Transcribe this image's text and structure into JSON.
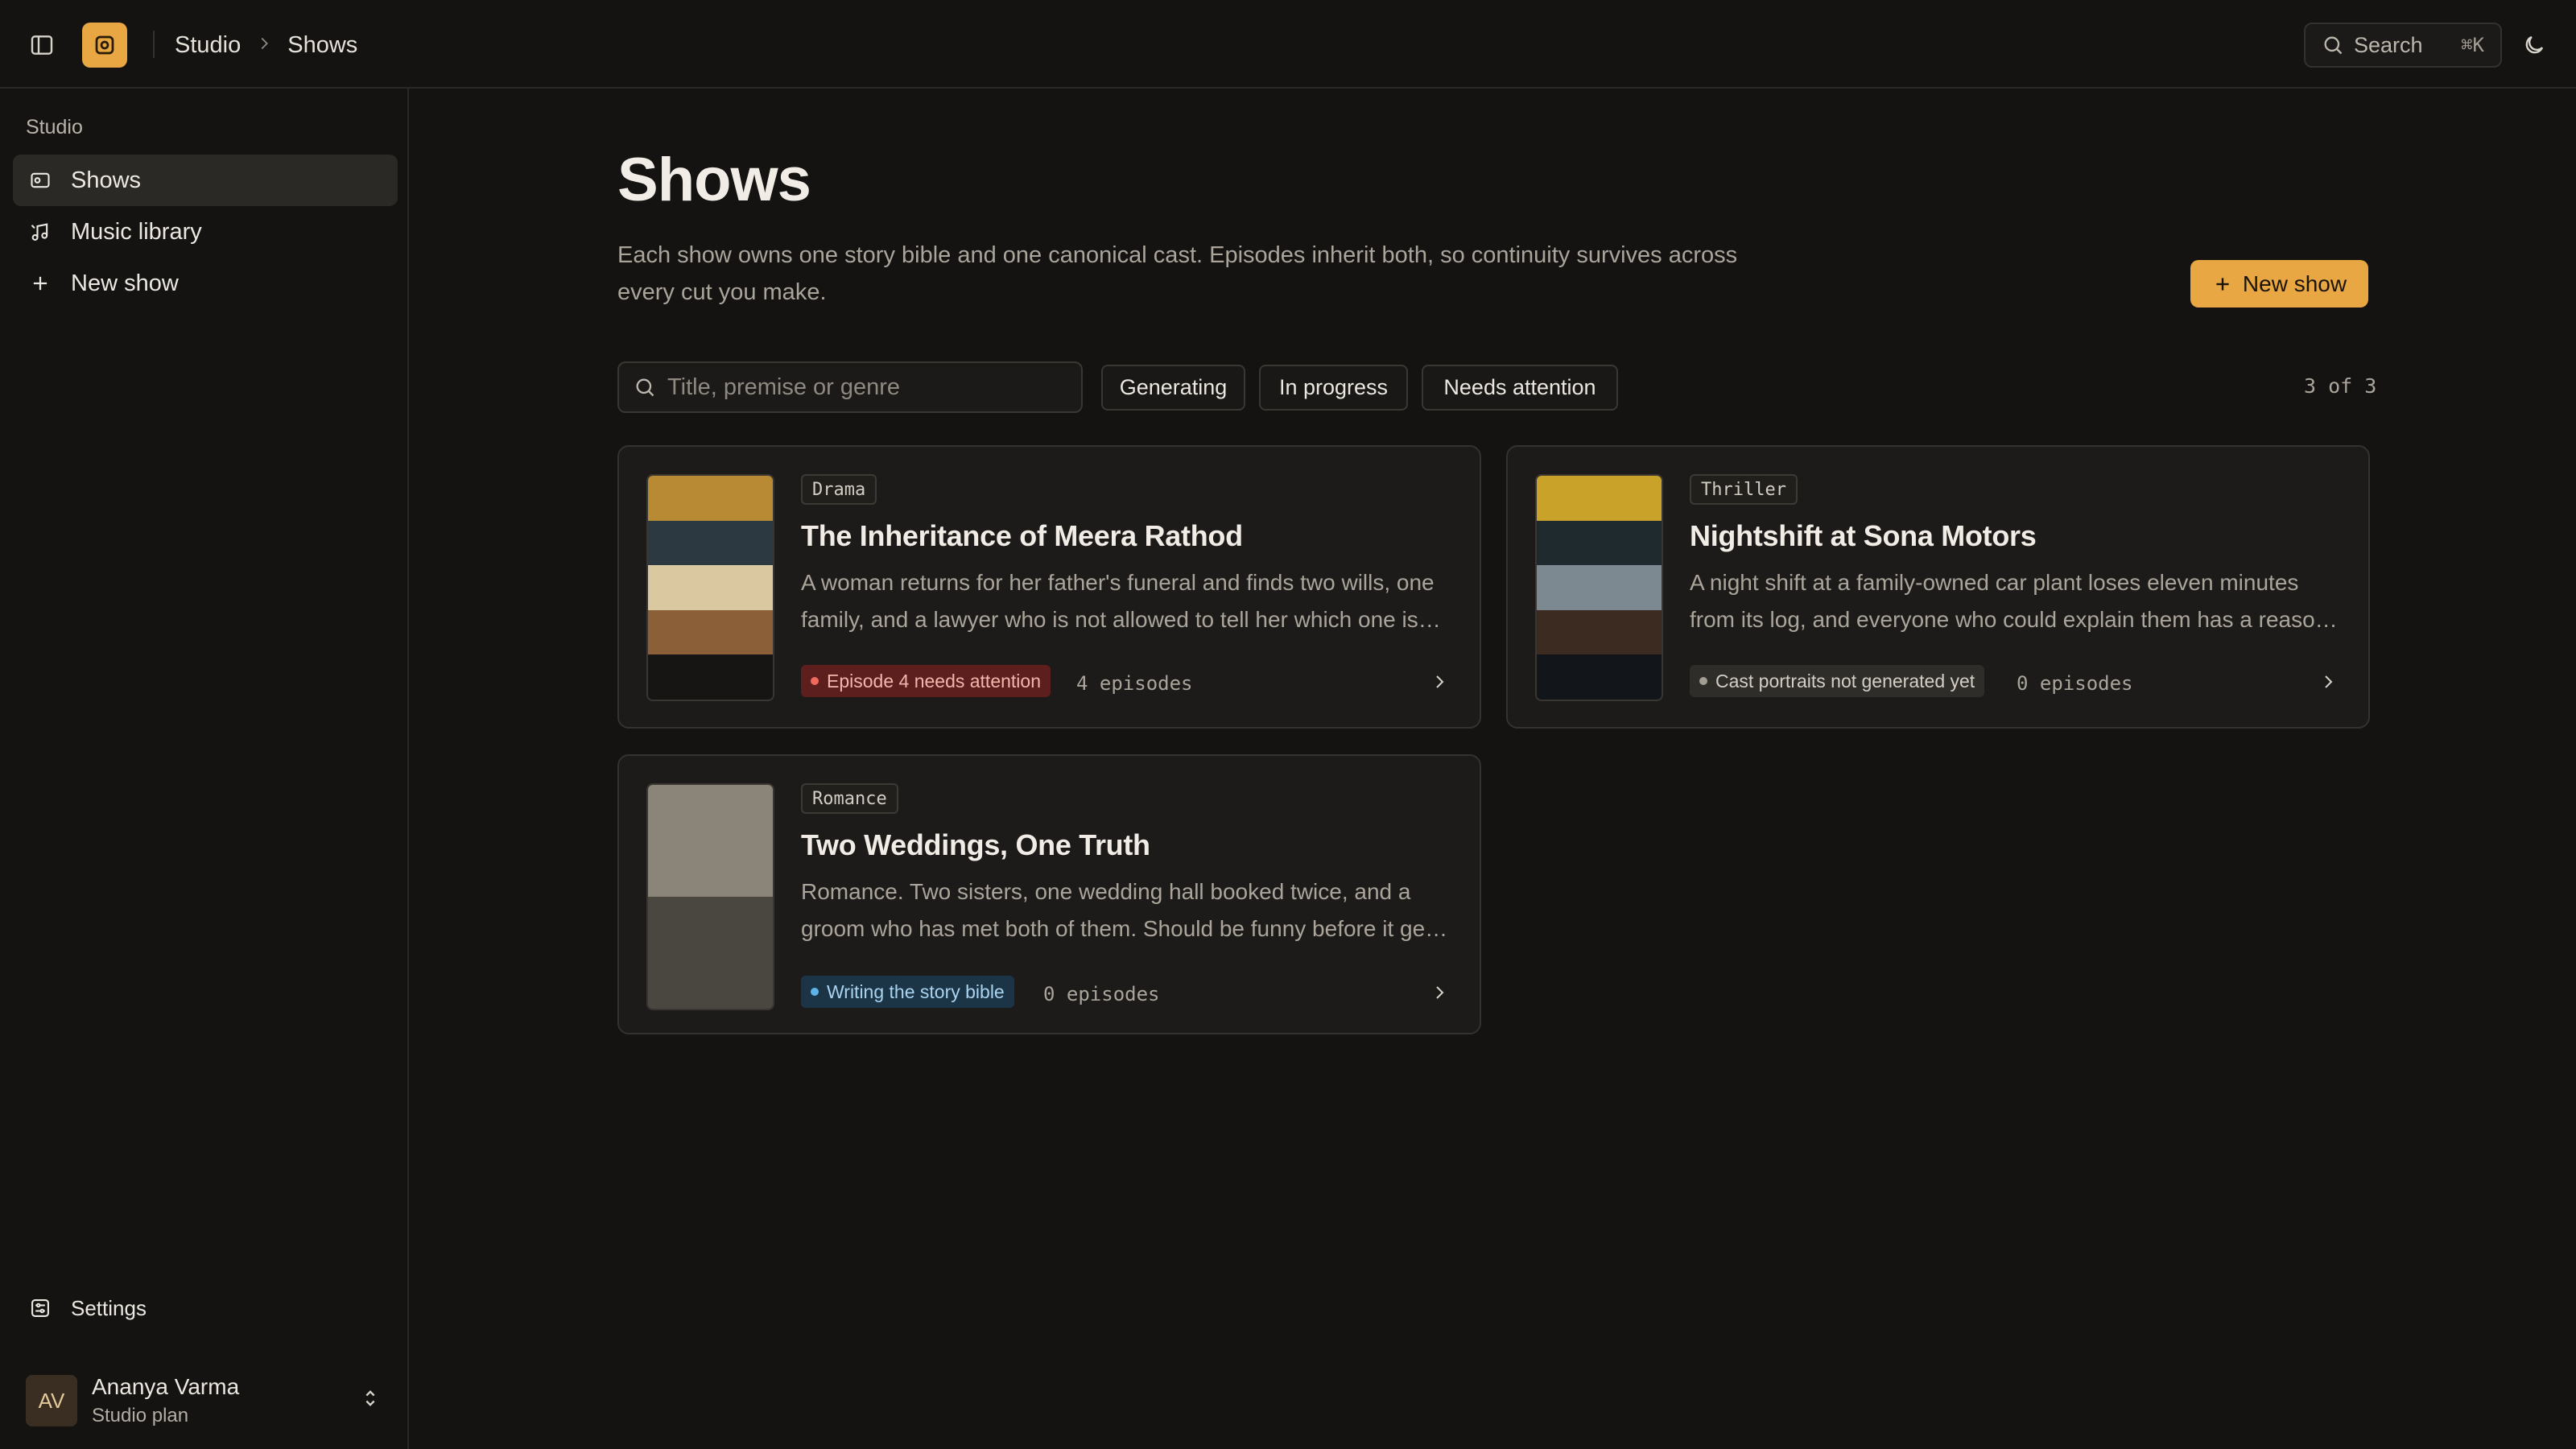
{
  "topbar": {
    "breadcrumb": [
      "Studio",
      "Shows"
    ],
    "search_label": "Search",
    "search_shortcut": "⌘K"
  },
  "sidebar": {
    "section_label": "Studio",
    "items": [
      {
        "label": "Shows",
        "icon": "shows-icon",
        "active": true
      },
      {
        "label": "Music library",
        "icon": "music-icon",
        "active": false
      },
      {
        "label": "New show",
        "icon": "plus-icon",
        "active": false
      }
    ],
    "settings_label": "Settings",
    "user": {
      "initials": "AV",
      "name": "Ananya Varma",
      "plan": "Studio plan"
    }
  },
  "main": {
    "title": "Shows",
    "description": "Each show owns one story bible and one canonical cast. Episodes inherit both, so continuity survives across every cut you make.",
    "new_show_label": "New show",
    "search_placeholder": "Title, premise or genre",
    "filters": [
      "Generating",
      "In progress",
      "Needs attention"
    ],
    "result_count": "3 of 3"
  },
  "cards": [
    {
      "genre": "Drama",
      "title": "The Inheritance of Meera Rathod",
      "description": "A woman returns for her father's funeral and finds two wills, one family, and a lawyer who is not allowed to tell her which one is real.",
      "status": "Episode 4 needs attention",
      "episodes": "4 episodes",
      "swatch": [
        "#b98a34",
        "#2c3940",
        "#dac8a1",
        "#8b5f38",
        "#161514"
      ],
      "status_colors": {
        "bg": "#5c1f1d",
        "fg": "#f2b6ad",
        "dot": "#ef6a5c"
      }
    },
    {
      "genre": "Thriller",
      "title": "Nightshift at Sona Motors",
      "description": "A night shift at a family-owned car plant loses eleven minutes from its log, and everyone who could explain them has a reason not to.",
      "status": "Cast portraits not generated yet",
      "episodes": "0 episodes",
      "swatch": [
        "#c9a229",
        "#1f2a2f",
        "#7c8990",
        "#3b2b20",
        "#12161a"
      ],
      "status_colors": {
        "bg": "#2f2d2a",
        "fg": "#d4cec5",
        "dot": "#a39d94"
      }
    },
    {
      "genre": "Romance",
      "title": "Two Weddings, One Truth",
      "description": "Romance. Two sisters, one wedding hall booked twice, and a groom who has met both of them. Should be funny before it gets serious.",
      "status": "Writing the story bible",
      "episodes": "0 episodes",
      "swatch": [
        "#8a8479",
        "#4a4640"
      ],
      "status_colors": {
        "bg": "#1c3546",
        "fg": "#a9d3ef",
        "dot": "#5fb3e8"
      }
    }
  ],
  "colors": {
    "accent": "#e8a743",
    "background": "#141312"
  }
}
